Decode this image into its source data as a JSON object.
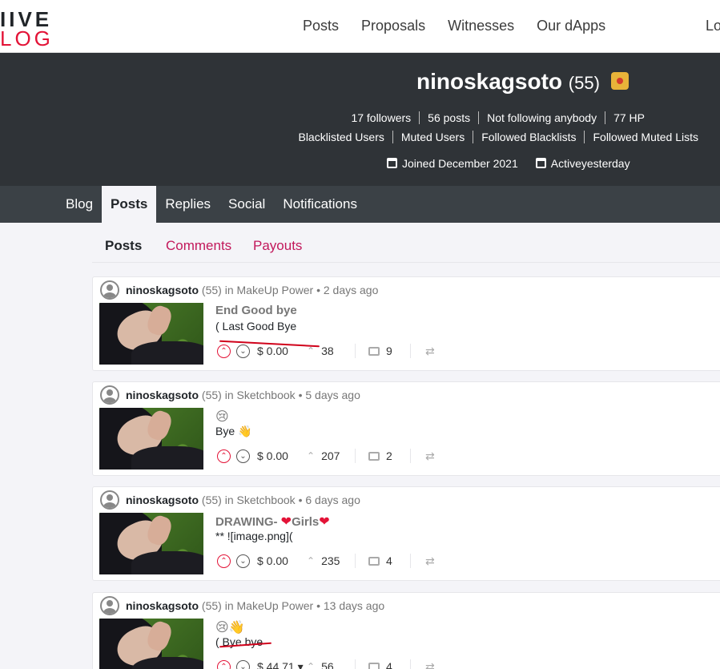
{
  "logo": {
    "line1": "IIVE",
    "line2": "LOG"
  },
  "nav": {
    "items": [
      "Posts",
      "Proposals",
      "Witnesses",
      "Our dApps"
    ],
    "login": "Lo"
  },
  "profile": {
    "name": "ninoskagsoto",
    "reputation": "(55)",
    "stats": [
      "17 followers",
      "56 posts",
      "Not following anybody",
      "77 HP"
    ],
    "lists": [
      "Blacklisted Users",
      "Muted Users",
      "Followed Blacklists",
      "Followed Muted Lists"
    ],
    "joined": "Joined December 2021",
    "active": "Activeyesterday"
  },
  "tabs": [
    {
      "label": "Blog",
      "active": false
    },
    {
      "label": "Posts",
      "active": true
    },
    {
      "label": "Replies",
      "active": false
    },
    {
      "label": "Social",
      "active": false
    },
    {
      "label": "Notifications",
      "active": false
    }
  ],
  "subtabs": [
    "Posts",
    "Comments",
    "Payouts"
  ],
  "posts": [
    {
      "author": "ninoskagsoto",
      "rep": "(55)",
      "in": "in",
      "community": "MakeUp Power",
      "time": "• 2 days ago",
      "title": "End Good bye",
      "summary": "( Last Good Bye",
      "payout": "$ 0.00",
      "votes": "38",
      "comments": "9"
    },
    {
      "author": "ninoskagsoto",
      "rep": "(55)",
      "in": "in",
      "community": "Sketchbook",
      "time": "• 5 days ago",
      "title": "😢",
      "summary": "Bye 👋",
      "payout": "$ 0.00",
      "votes": "207",
      "comments": "2"
    },
    {
      "author": "ninoskagsoto",
      "rep": "(55)",
      "in": "in",
      "community": "Sketchbook",
      "time": "• 6 days ago",
      "title_a": "DRAWING- ",
      "title_b": "Girls",
      "summary": "** ![image.png](",
      "payout": "$ 0.00",
      "votes": "235",
      "comments": "4"
    },
    {
      "author": "ninoskagsoto",
      "rep": "(55)",
      "in": "in",
      "community": "MakeUp Power",
      "time": "• 13 days ago",
      "title": "😢👋",
      "summary": "( Bye bye",
      "payout": "$ 44.71 ▾",
      "votes": "56",
      "comments": "4"
    }
  ],
  "icons": {
    "upvote": "chevron-up-icon",
    "downvote": "chevron-down-icon",
    "reblog": "reblog-icon",
    "calendar": "calendar-icon"
  },
  "colors": {
    "accent": "#e31337",
    "header": "#2f3337",
    "tabs": "#3b4146",
    "link": "#c2185b"
  }
}
